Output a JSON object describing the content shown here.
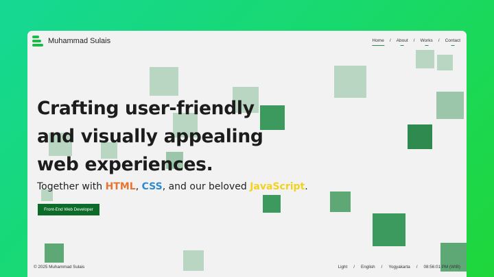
{
  "brand": {
    "name": "Muhammad Sulais",
    "logo_color": "#1fb84a"
  },
  "nav": {
    "items": [
      "Home",
      "About",
      "Works",
      "Contact"
    ],
    "separator": "/",
    "active": "Home"
  },
  "hero": {
    "headline_lines": [
      "Crafting user-friendly",
      "and visually appealing",
      "web experiences."
    ],
    "sub_prefix": "Together with ",
    "sub_html": "HTML",
    "sub_comma1": ", ",
    "sub_css": "CSS",
    "sub_middle": ", and our beloved ",
    "sub_js": "JavaScript",
    "sub_end": ".",
    "colors": {
      "html": "#e8742f",
      "css": "#2d8ad0",
      "js": "#f2d21e"
    },
    "cta_label": "Front-End Web Developer"
  },
  "footer": {
    "copyright": "© 2025 Muhammad Sulais",
    "theme": "Light",
    "language": "English",
    "city": "Yogyakarta",
    "time": "08:56:01 PM (WIB)",
    "separator": "/"
  }
}
